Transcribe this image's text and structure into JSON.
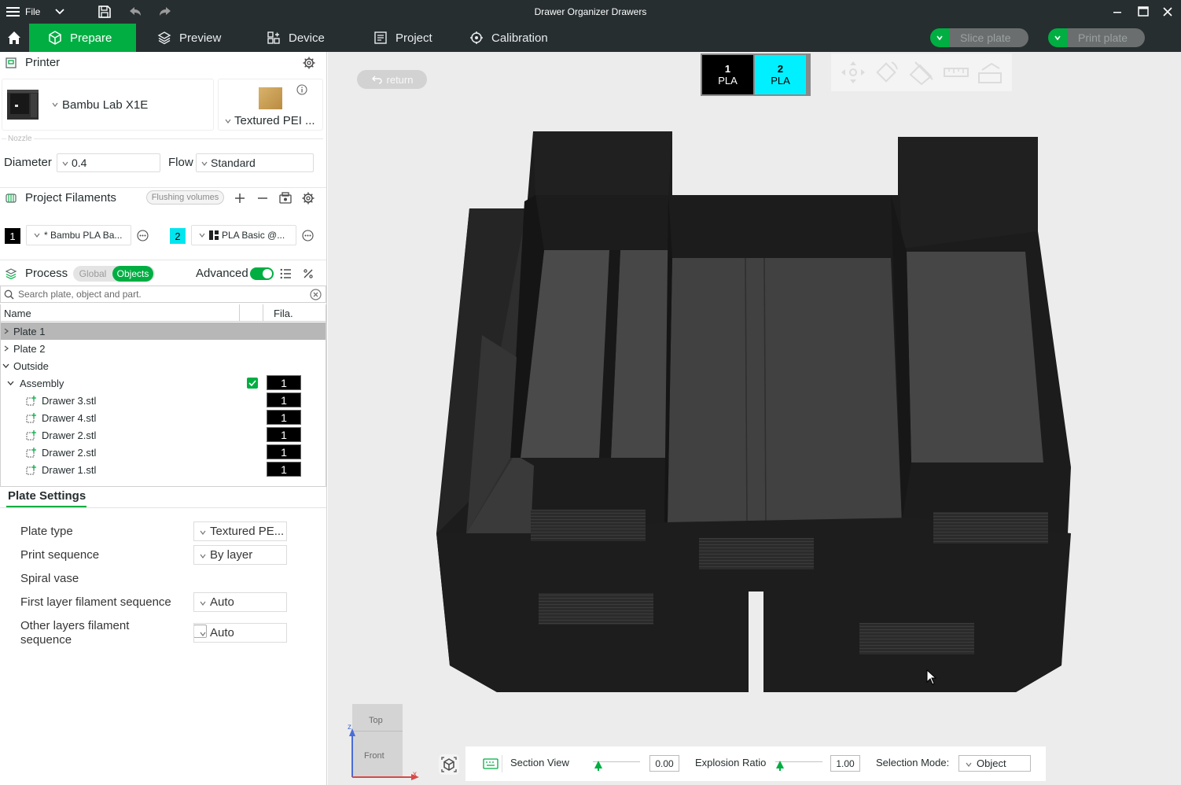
{
  "titlebar": {
    "file_label": "File",
    "window_title": "Drawer Organizer Drawers"
  },
  "tabs": {
    "prepare": "Prepare",
    "preview": "Preview",
    "device": "Device",
    "project": "Project",
    "calibration": "Calibration",
    "slice": "Slice plate",
    "print": "Print plate"
  },
  "printer": {
    "header": "Printer",
    "model": "Bambu Lab X1E",
    "plate": "Textured PEI ...",
    "nozzle_label": "Nozzle",
    "diameter_label": "Diameter",
    "diameter_value": "0.4",
    "flow_label": "Flow",
    "flow_value": "Standard"
  },
  "filaments": {
    "header": "Project Filaments",
    "flushing": "Flushing volumes",
    "items": [
      {
        "num": "1",
        "name": "Bambu PLA Ba...",
        "color": "#000000"
      },
      {
        "num": "2",
        "name": "PLA Basic @...",
        "color": "#00e5ee"
      }
    ]
  },
  "process": {
    "header": "Process",
    "global": "Global",
    "objects": "Objects",
    "advanced": "Advanced",
    "search_placeholder": "Search plate, object and part."
  },
  "tree": {
    "col_name": "Name",
    "col_fila": "Fila.",
    "rows": [
      {
        "label": "Plate 1",
        "fila": ""
      },
      {
        "label": "Plate 2",
        "fila": ""
      },
      {
        "label": "Outside",
        "fila": ""
      },
      {
        "label": "Assembly",
        "fila": "1"
      },
      {
        "label": "Drawer 3.stl",
        "fila": "1"
      },
      {
        "label": "Drawer 4.stl",
        "fila": "1"
      },
      {
        "label": "Drawer 2.stl",
        "fila": "1"
      },
      {
        "label": "Drawer 2.stl",
        "fila": "1"
      },
      {
        "label": "Drawer 1.stl",
        "fila": "1"
      }
    ]
  },
  "plate_settings": {
    "tab": "Plate Settings",
    "plate_type_label": "Plate type",
    "plate_type_value": "Textured PE...",
    "print_seq_label": "Print sequence",
    "print_seq_value": "By layer",
    "spiral_label": "Spiral vase",
    "first_layer_label": "First layer filament sequence",
    "first_layer_value": "Auto",
    "other_layers_label_1": "Other layers filament",
    "other_layers_label_2": "sequence",
    "other_layers_value": "Auto"
  },
  "viewport": {
    "return_label": "return",
    "filament_tabs": [
      {
        "num": "1",
        "type": "PLA",
        "color": "#000000",
        "text": "#ffffff"
      },
      {
        "num": "2",
        "type": "PLA",
        "color": "#00f0ff",
        "text": "#000000"
      }
    ],
    "cube_top": "Top",
    "cube_front": "Front",
    "section_view": "Section View",
    "section_value": "0.00",
    "explosion_label": "Explosion Ratio",
    "explosion_value": "1.00",
    "selection_label": "Selection Mode:",
    "selection_value": "Object"
  },
  "colors": {
    "accent": "#00ae42",
    "toolbar_bg": "#262e30"
  }
}
